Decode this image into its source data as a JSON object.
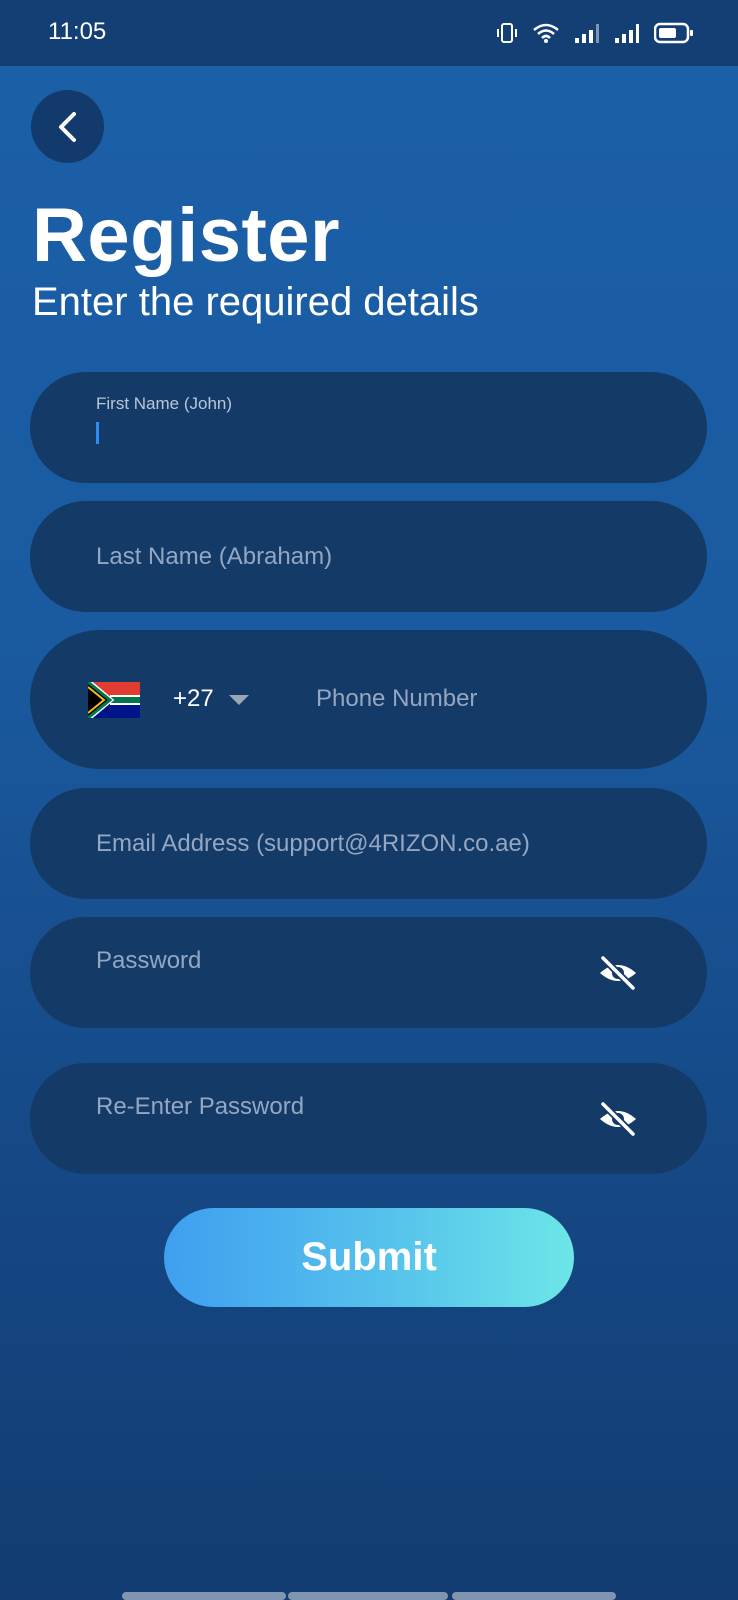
{
  "status_bar": {
    "time": "11:05",
    "icons": [
      "vibrate-icon",
      "wifi-icon",
      "signal-icon",
      "signal-icon",
      "battery-icon"
    ]
  },
  "header": {
    "back_icon": "chevron-left-icon",
    "title": "Register",
    "subtitle": "Enter the required details"
  },
  "form": {
    "first_name": {
      "label": "First Name (John)",
      "value": ""
    },
    "last_name": {
      "placeholder": "Last Name (Abraham)"
    },
    "phone": {
      "country_flag": "south-africa-flag-icon",
      "dial_code": "+27",
      "placeholder": "Phone Number"
    },
    "email": {
      "placeholder": "Email Address (support@4RIZON.co.ae)"
    },
    "password": {
      "placeholder": "Password",
      "toggle_icon": "eye-off-icon"
    },
    "confirm_password": {
      "placeholder": "Re-Enter Password",
      "toggle_icon": "eye-off-icon"
    }
  },
  "submit_label": "Submit",
  "colors": {
    "background_top": "#1b60a8",
    "background_bottom": "#123c72",
    "field_bg": "#143a68",
    "submit_gradient_start": "#3f9ff0",
    "submit_gradient_end": "#6ce6e8",
    "cursor": "#2f8cf0"
  }
}
